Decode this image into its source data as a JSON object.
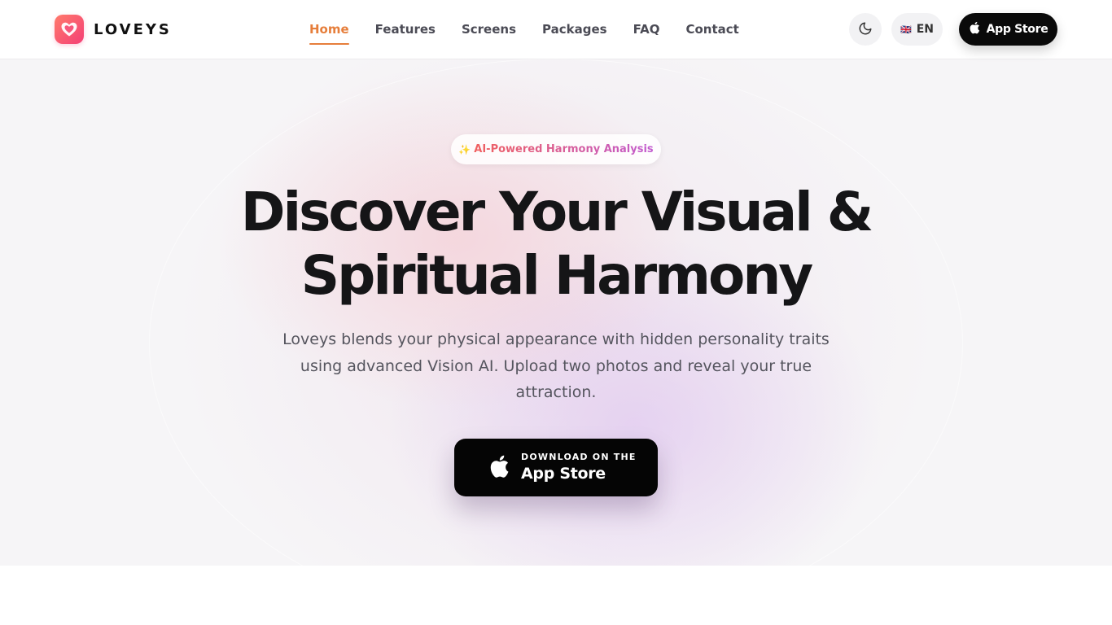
{
  "brand": {
    "name": "LOVEYS"
  },
  "nav": {
    "items": [
      {
        "label": "Home",
        "active": true
      },
      {
        "label": "Features",
        "active": false
      },
      {
        "label": "Screens",
        "active": false
      },
      {
        "label": "Packages",
        "active": false
      },
      {
        "label": "FAQ",
        "active": false
      },
      {
        "label": "Contact",
        "active": false
      }
    ]
  },
  "header": {
    "theme_icon": "moon-icon",
    "language": {
      "flag": "🇬🇧",
      "code": "EN"
    },
    "app_store_label": "App Store"
  },
  "hero": {
    "badge": {
      "icon": "✨",
      "text": "AI-Powered Harmony Analysis"
    },
    "headline_line1": "Discover Your Visual &",
    "headline_line2": "Spiritual Harmony",
    "subtext": "Loveys blends your physical appearance with hidden personality traits using advanced Vision AI. Upload two photos and reveal your true attraction.",
    "cta": {
      "small": "DOWNLOAD ON THE",
      "big": "App Store"
    }
  },
  "colors": {
    "accent": "#e67e3b",
    "brand_gradient_start": "#ff7a6b",
    "brand_gradient_end": "#f43f76",
    "dark": "#0a0a0a"
  }
}
